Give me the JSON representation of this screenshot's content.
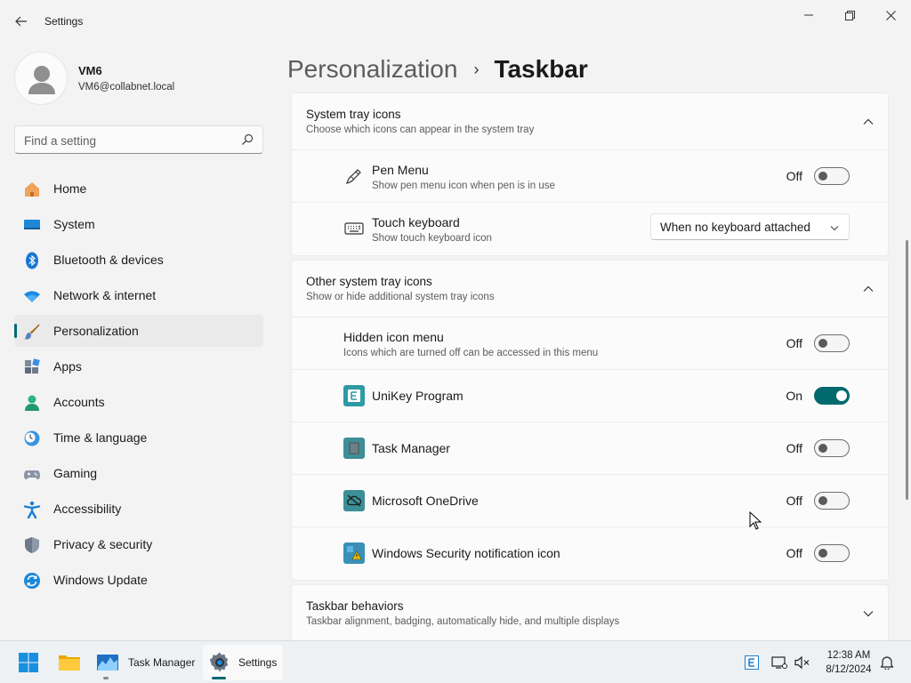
{
  "window": {
    "title": "Settings",
    "controls": [
      "minimize",
      "restore",
      "close"
    ]
  },
  "profile": {
    "name": "VM6",
    "email": "VM6@collabnet.local"
  },
  "search": {
    "placeholder": "Find a setting"
  },
  "sidebar": {
    "items": [
      {
        "label": "Home",
        "icon": "home-icon"
      },
      {
        "label": "System",
        "icon": "system-icon"
      },
      {
        "label": "Bluetooth & devices",
        "icon": "bluetooth-icon"
      },
      {
        "label": "Network & internet",
        "icon": "wifi-icon"
      },
      {
        "label": "Personalization",
        "icon": "paintbrush-icon",
        "active": true
      },
      {
        "label": "Apps",
        "icon": "apps-icon"
      },
      {
        "label": "Accounts",
        "icon": "accounts-icon"
      },
      {
        "label": "Time & language",
        "icon": "clock-globe-icon"
      },
      {
        "label": "Gaming",
        "icon": "gamepad-icon"
      },
      {
        "label": "Accessibility",
        "icon": "accessibility-icon"
      },
      {
        "label": "Privacy & security",
        "icon": "shield-icon"
      },
      {
        "label": "Windows Update",
        "icon": "update-icon"
      }
    ]
  },
  "breadcrumb": {
    "parent": "Personalization",
    "separator": "›",
    "current": "Taskbar"
  },
  "sections": {
    "system_tray": {
      "title": "System tray icons",
      "subtitle": "Choose which icons can appear in the system tray",
      "pen_menu": {
        "title": "Pen Menu",
        "subtitle": "Show pen menu icon when pen is in use",
        "state": "Off"
      },
      "touch_keyboard": {
        "title": "Touch keyboard",
        "subtitle": "Show touch keyboard icon",
        "dropdown_value": "When no keyboard attached"
      }
    },
    "other_tray": {
      "title": "Other system tray icons",
      "subtitle": "Show or hide additional system tray icons",
      "hidden_menu": {
        "title": "Hidden icon menu",
        "subtitle": "Icons which are turned off can be accessed in this menu",
        "state": "Off"
      },
      "unikey": {
        "title": "UniKey Program",
        "state": "On"
      },
      "task_manager": {
        "title": "Task Manager",
        "state": "Off"
      },
      "onedrive": {
        "title": "Microsoft OneDrive",
        "state": "Off"
      },
      "win_security": {
        "title": "Windows Security notification icon",
        "state": "Off"
      }
    },
    "behaviors": {
      "title": "Taskbar behaviors",
      "subtitle": "Taskbar alignment, badging, automatically hide, and multiple displays"
    }
  },
  "taskbar": {
    "apps": [
      {
        "label": "",
        "icon": "start-icon"
      },
      {
        "label": "",
        "icon": "file-explorer-icon"
      },
      {
        "label": "Task Manager",
        "icon": "task-manager-icon"
      },
      {
        "label": "Settings",
        "icon": "settings-gear-icon",
        "active": true
      }
    ],
    "time": "12:38 AM",
    "date": "8/12/2024"
  },
  "colors": {
    "accent": "#00696e",
    "background": "#f3f3f3",
    "card": "#fbfbfb"
  }
}
